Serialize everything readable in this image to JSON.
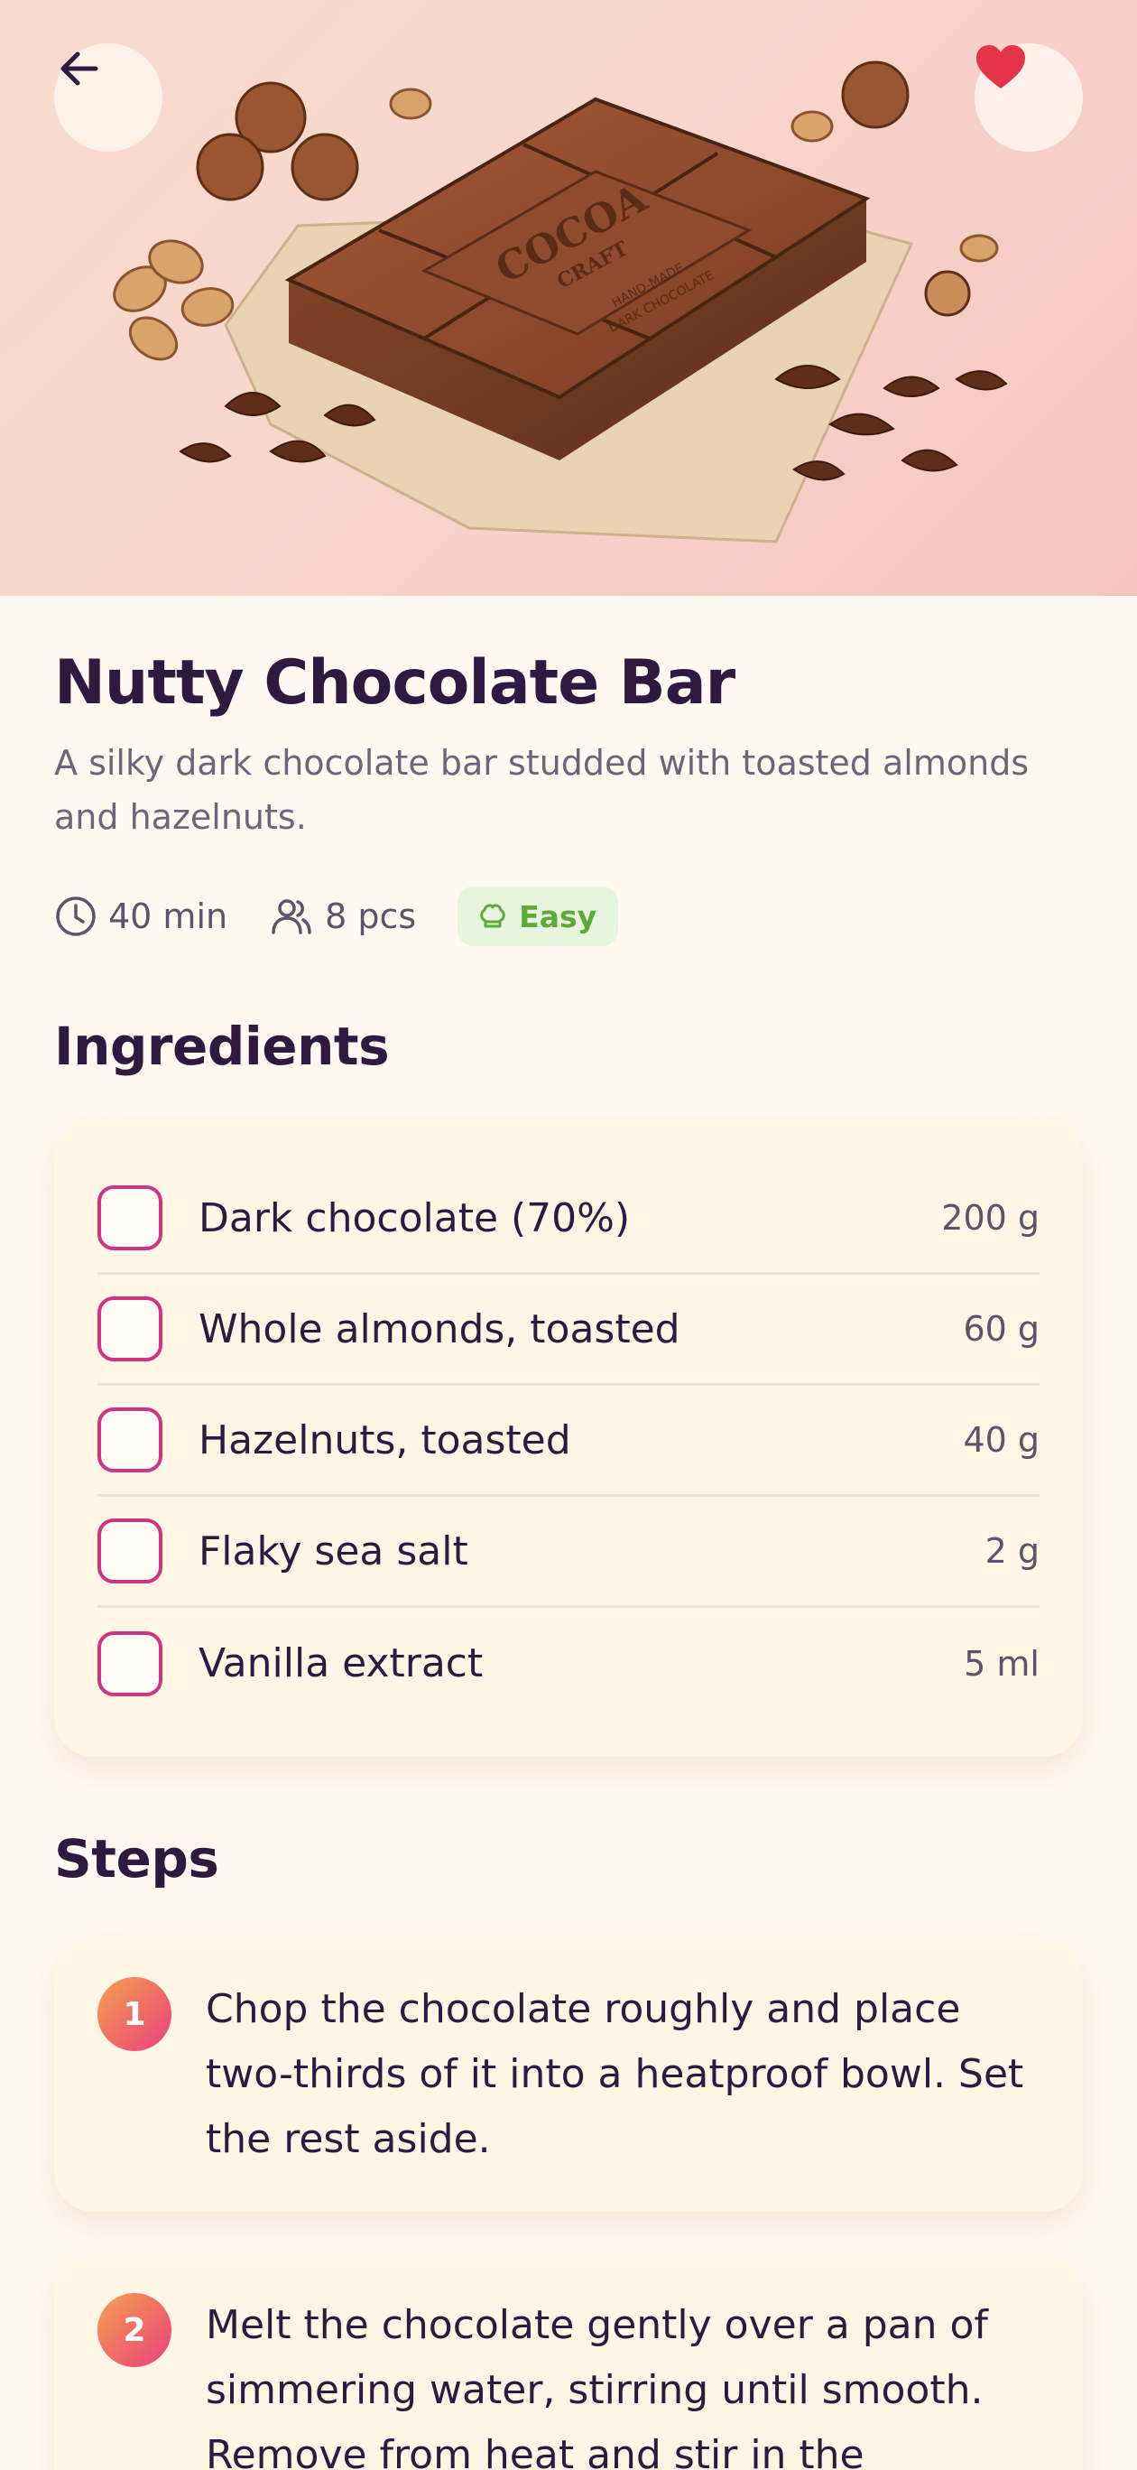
{
  "hero": {
    "image_alt": "Chocolate bar with nuts",
    "bar_logo": "COCOA",
    "bar_logo_sub": "CRAFT",
    "bar_tagline_1": "HAND-MADE",
    "bar_tagline_2": "DARK CHOCOLATE",
    "back_icon": "arrow-left-icon",
    "favorite_icon": "heart-icon",
    "favorite_color": "#E5334B"
  },
  "recipe": {
    "title": "Nutty Chocolate Bar",
    "description": "A silky dark chocolate bar studded with toasted almonds and hazelnuts.",
    "time": "40 min",
    "yield": "8 pcs",
    "difficulty": "Easy"
  },
  "ingredients": {
    "heading": "Ingredients",
    "items": [
      {
        "name": "Dark chocolate (70%)",
        "amount": "200 g",
        "checked": false
      },
      {
        "name": "Whole almonds, toasted",
        "amount": "60 g",
        "checked": false
      },
      {
        "name": "Hazelnuts, toasted",
        "amount": "40 g",
        "checked": false
      },
      {
        "name": "Flaky sea salt",
        "amount": "2 g",
        "checked": false
      },
      {
        "name": "Vanilla extract",
        "amount": "5 ml",
        "checked": false
      }
    ]
  },
  "steps": {
    "heading": "Steps",
    "items": [
      {
        "number": "1",
        "text": "Chop the chocolate roughly and place two-thirds of it into a heatproof bowl. Set the rest aside."
      },
      {
        "number": "2",
        "text": "Melt the chocolate gently over a pan of simmering water, stirring until smooth. Remove from heat and stir in the"
      }
    ]
  },
  "colors": {
    "accent": "#D1347F",
    "title": "#2E1A3E",
    "badge_green": "#5FA83A"
  }
}
